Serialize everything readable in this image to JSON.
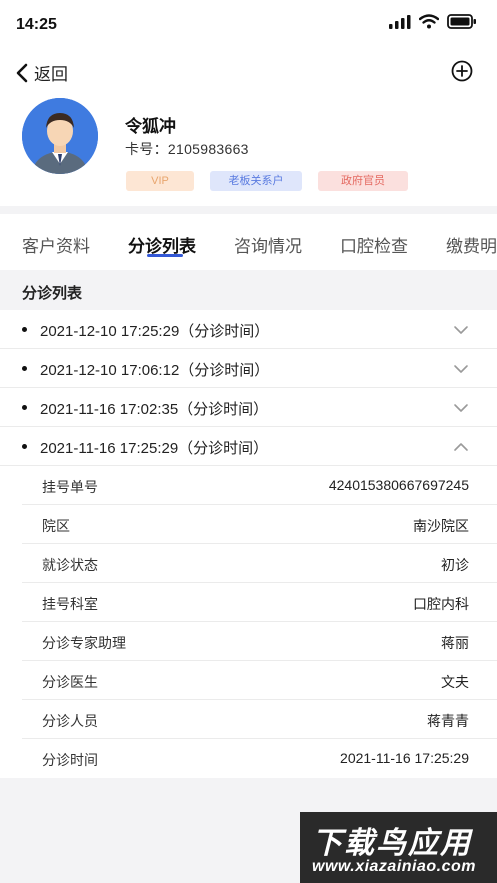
{
  "status_bar": {
    "time": "14:25"
  },
  "nav": {
    "back_label": "返回"
  },
  "profile": {
    "name": "令狐冲",
    "card_label": "卡号：",
    "card_number": "2105983663",
    "tags": [
      "VIP",
      "老板关系户",
      "政府官员"
    ]
  },
  "tabs": [
    "客户资料",
    "分诊列表",
    "咨询情况",
    "口腔检查",
    "缴费明"
  ],
  "active_tab": "分诊列表",
  "section": {
    "title": "分诊列表"
  },
  "triage_list": [
    {
      "text": "2021-12-10 17:25:29（分诊时间）",
      "expanded": false
    },
    {
      "text": "2021-12-10 17:06:12（分诊时间）",
      "expanded": false
    },
    {
      "text": "2021-11-16 17:02:35（分诊时间）",
      "expanded": false
    },
    {
      "text": "2021-11-16 17:25:29（分诊时间）",
      "expanded": true
    }
  ],
  "detail": [
    {
      "label": "挂号单号",
      "value": "424015380667697245"
    },
    {
      "label": "院区",
      "value": "南沙院区"
    },
    {
      "label": "就诊状态",
      "value": "初诊"
    },
    {
      "label": "挂号科室",
      "value": "口腔内科"
    },
    {
      "label": "分诊专家助理",
      "value": "蒋丽"
    },
    {
      "label": "分诊医生",
      "value": "文夫"
    },
    {
      "label": "分诊人员",
      "value": "蒋青青"
    },
    {
      "label": "分诊时间",
      "value": "2021-11-16 17:25:29"
    }
  ],
  "watermark": {
    "title": "下载鸟应用",
    "url": "www.xiazainiao.com"
  },
  "colors": {
    "accent": "#3358d6",
    "vip": "#e8a56d",
    "boss": "#5a7be0",
    "gov": "#e46a62"
  },
  "icons": [
    "signal-icon",
    "wifi-icon",
    "battery-icon",
    "back-chevron-icon",
    "add-circle-icon",
    "avatar",
    "chevron-down-icon",
    "chevron-up-icon"
  ]
}
